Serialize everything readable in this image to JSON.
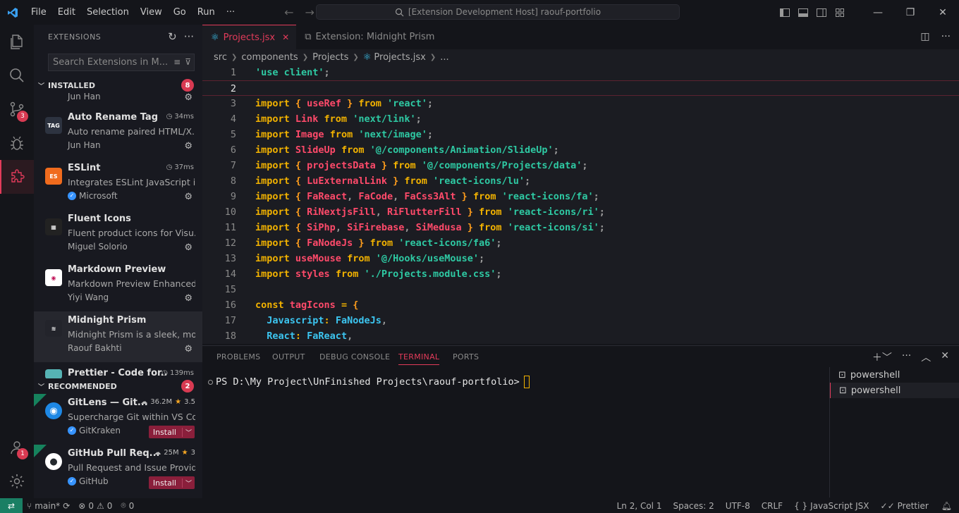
{
  "titlebar": {
    "menu": [
      "File",
      "Edit",
      "Selection",
      "View",
      "Go",
      "Run",
      "···"
    ],
    "command_center": "[Extension Development Host] raouf-portfolio"
  },
  "activity_badges": {
    "source_control": "3",
    "accounts": "1"
  },
  "sidebar": {
    "title": "EXTENSIONS",
    "search_placeholder": "Search Extensions in M...",
    "installed_label": "INSTALLED",
    "installed_count": "8",
    "recommended_label": "RECOMMENDED",
    "recommended_count": "2",
    "partial_top_publisher": "Jun Han",
    "installed": [
      {
        "name": "Auto Rename Tag",
        "desc": "Auto rename paired HTML/X...",
        "publisher": "Jun Han",
        "time": "34ms",
        "verified": false,
        "icon_color": "#2d3340",
        "icon_text": "TAG"
      },
      {
        "name": "ESLint",
        "desc": "Integrates ESLint JavaScript i...",
        "publisher": "Microsoft",
        "time": "37ms",
        "verified": true,
        "icon_color": "#f06b1d",
        "icon_text": "ES"
      },
      {
        "name": "Fluent Icons",
        "desc": "Fluent product icons for Visu...",
        "publisher": "Miguel Solorio",
        "time": "",
        "verified": false,
        "icon_color": "#222",
        "icon_text": "▦"
      },
      {
        "name": "Markdown Preview Enhanced",
        "desc": "Markdown Preview Enhanced...",
        "publisher": "Yiyi Wang",
        "time": "",
        "verified": false,
        "icon_color": "#ffffff",
        "icon_text": "◉"
      },
      {
        "name": "Midnight Prism",
        "desc": "Midnight Prism is a sleek, mo...",
        "publisher": "Raouf Bakhti",
        "time": "",
        "verified": false,
        "icon_color": "#23242b",
        "icon_text": "≋"
      }
    ],
    "partial_bottom": {
      "name": "Prettier - Code for...",
      "time": "139ms"
    },
    "recommended": [
      {
        "name": "GitLens — Git...",
        "desc": "Supercharge Git within VS Co...",
        "publisher": "GitKraken",
        "downloads": "36.2M",
        "rating": "3.5",
        "install": "Install"
      },
      {
        "name": "GitHub Pull Req...",
        "desc": "Pull Request and Issue Provid...",
        "publisher": "GitHub",
        "downloads": "25M",
        "rating": "3",
        "install": "Install"
      }
    ]
  },
  "tabs": [
    {
      "label": "Projects.jsx",
      "active": true
    },
    {
      "label": "Extension: Midnight Prism",
      "active": false
    }
  ],
  "breadcrumb": [
    "src",
    "components",
    "Projects",
    "Projects.jsx",
    "..."
  ],
  "code_lines": [
    [
      [
        "str",
        "'use client'"
      ],
      [
        "pun",
        ";"
      ]
    ],
    [],
    [
      [
        "kw",
        "import "
      ],
      [
        "br",
        "{ "
      ],
      [
        "id",
        "useRef"
      ],
      [
        "br",
        " } "
      ],
      [
        "kw",
        "from "
      ],
      [
        "str",
        "'react'"
      ],
      [
        "pun",
        ";"
      ]
    ],
    [
      [
        "kw",
        "import "
      ],
      [
        "id",
        "Link "
      ],
      [
        "kw",
        "from "
      ],
      [
        "str",
        "'next/link'"
      ],
      [
        "pun",
        ";"
      ]
    ],
    [
      [
        "kw",
        "import "
      ],
      [
        "id",
        "Image "
      ],
      [
        "kw",
        "from "
      ],
      [
        "str",
        "'next/image'"
      ],
      [
        "pun",
        ";"
      ]
    ],
    [
      [
        "kw",
        "import "
      ],
      [
        "id",
        "SlideUp "
      ],
      [
        "kw",
        "from "
      ],
      [
        "str",
        "'@/components/Animation/SlideUp'"
      ],
      [
        "pun",
        ";"
      ]
    ],
    [
      [
        "kw",
        "import "
      ],
      [
        "br",
        "{ "
      ],
      [
        "id",
        "projectsData"
      ],
      [
        "br",
        " } "
      ],
      [
        "kw",
        "from "
      ],
      [
        "str",
        "'@/components/Projects/data'"
      ],
      [
        "pun",
        ";"
      ]
    ],
    [
      [
        "kw",
        "import "
      ],
      [
        "br",
        "{ "
      ],
      [
        "id",
        "LuExternalLink"
      ],
      [
        "br",
        " } "
      ],
      [
        "kw",
        "from "
      ],
      [
        "str",
        "'react-icons/lu'"
      ],
      [
        "pun",
        ";"
      ]
    ],
    [
      [
        "kw",
        "import "
      ],
      [
        "br",
        "{ "
      ],
      [
        "id",
        "FaReact"
      ],
      [
        "pun",
        ", "
      ],
      [
        "id",
        "FaCode"
      ],
      [
        "pun",
        ", "
      ],
      [
        "id",
        "FaCss3Alt"
      ],
      [
        "br",
        " } "
      ],
      [
        "kw",
        "from "
      ],
      [
        "str",
        "'react-icons/fa'"
      ],
      [
        "pun",
        ";"
      ]
    ],
    [
      [
        "kw",
        "import "
      ],
      [
        "br",
        "{ "
      ],
      [
        "id",
        "RiNextjsFill"
      ],
      [
        "pun",
        ", "
      ],
      [
        "id",
        "RiFlutterFill"
      ],
      [
        "br",
        " } "
      ],
      [
        "kw",
        "from "
      ],
      [
        "str",
        "'react-icons/ri'"
      ],
      [
        "pun",
        ";"
      ]
    ],
    [
      [
        "kw",
        "import "
      ],
      [
        "br",
        "{ "
      ],
      [
        "id",
        "SiPhp"
      ],
      [
        "pun",
        ", "
      ],
      [
        "id",
        "SiFirebase"
      ],
      [
        "pun",
        ", "
      ],
      [
        "id",
        "SiMedusa"
      ],
      [
        "br",
        " } "
      ],
      [
        "kw",
        "from "
      ],
      [
        "str",
        "'react-icons/si'"
      ],
      [
        "pun",
        ";"
      ]
    ],
    [
      [
        "kw",
        "import "
      ],
      [
        "br",
        "{ "
      ],
      [
        "id",
        "FaNodeJs"
      ],
      [
        "br",
        " } "
      ],
      [
        "kw",
        "from "
      ],
      [
        "str",
        "'react-icons/fa6'"
      ],
      [
        "pun",
        ";"
      ]
    ],
    [
      [
        "kw",
        "import "
      ],
      [
        "id",
        "useMouse "
      ],
      [
        "kw",
        "from "
      ],
      [
        "str",
        "'@/Hooks/useMouse'"
      ],
      [
        "pun",
        ";"
      ]
    ],
    [
      [
        "kw",
        "import "
      ],
      [
        "id",
        "styles "
      ],
      [
        "kw",
        "from "
      ],
      [
        "str",
        "'./Projects.module.css'"
      ],
      [
        "pun",
        ";"
      ]
    ],
    [],
    [
      [
        "kw",
        "const "
      ],
      [
        "id",
        "tagIcons "
      ],
      [
        "kw",
        "= "
      ],
      [
        "br",
        "{"
      ]
    ],
    [
      [
        "pun",
        "  "
      ],
      [
        "prop",
        "Javascript"
      ],
      [
        "kw",
        ": "
      ],
      [
        "prop",
        "FaNodeJs"
      ],
      [
        "pun",
        ","
      ]
    ],
    [
      [
        "pun",
        "  "
      ],
      [
        "prop",
        "React"
      ],
      [
        "kw",
        ": "
      ],
      [
        "prop",
        "FaReact"
      ],
      [
        "pun",
        ","
      ]
    ]
  ],
  "current_line": 2,
  "panel": {
    "tabs": [
      "PROBLEMS",
      "OUTPUT",
      "DEBUG CONSOLE",
      "TERMINAL",
      "PORTS"
    ],
    "active_tab": "TERMINAL",
    "prompt": "PS D:\\My Project\\UnFinished Projects\\raouf-portfolio>",
    "terminals": [
      "powershell",
      "powershell"
    ]
  },
  "statusbar": {
    "branch": "main*",
    "errors": "0",
    "warnings": "0",
    "ports": "0",
    "position": "Ln 2, Col 1",
    "spaces": "Spaces: 2",
    "encoding": "UTF-8",
    "eol": "CRLF",
    "language": "JavaScript JSX",
    "formatter": "Prettier"
  }
}
